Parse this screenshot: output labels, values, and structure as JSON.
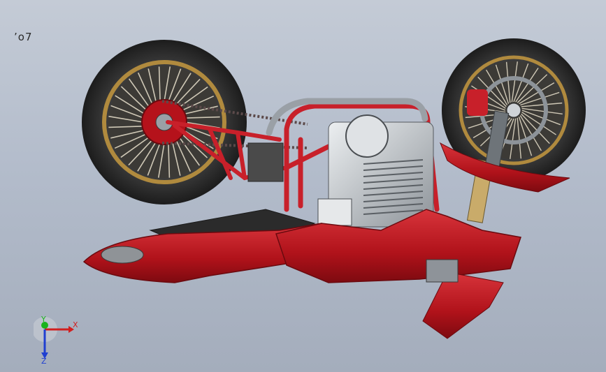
{
  "viewport": {
    "view_label": "’o7"
  },
  "model": {
    "colors": {
      "body_red": "#b5121b",
      "frame_red": "#c8202a",
      "tire": "#2a2a2a",
      "rim_gold": "#b08a3e",
      "engine_gray": "#8e9399",
      "chrome": "#d0d3d6"
    }
  },
  "triad": {
    "x_label": "X",
    "y_label": "Y",
    "z_label": "Z",
    "colors": {
      "x": "#d11f1f",
      "y": "#19b31c",
      "z": "#1f3fd1"
    }
  }
}
